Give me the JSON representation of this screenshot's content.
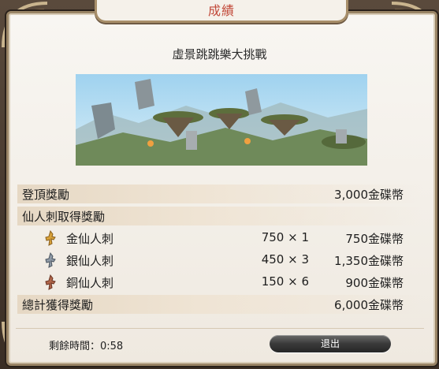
{
  "window": {
    "title": "成績"
  },
  "stage": {
    "name": "虛景跳跳樂大挑戰"
  },
  "rewards": {
    "summit": {
      "label": "登頂獎勵",
      "amount": "3,000金碟幣"
    },
    "cactus_header": {
      "label": "仙人刺取得獎勵"
    },
    "items": [
      {
        "icon": "gold-cactuar-icon",
        "label": "金仙人刺",
        "qty": "750 × 1",
        "amount": "750金碟幣"
      },
      {
        "icon": "silver-cactuar-icon",
        "label": "銀仙人刺",
        "qty": "450 × 3",
        "amount": "1,350金碟幣"
      },
      {
        "icon": "bronze-cactuar-icon",
        "label": "銅仙人刺",
        "qty": "150 × 6",
        "amount": "900金碟幣"
      }
    ],
    "total": {
      "label": "總計獲得獎勵",
      "amount": "6,000金碟幣"
    }
  },
  "footer": {
    "time_remaining": "剩餘時間：0:58",
    "exit_label": "退出"
  },
  "colors": {
    "title": "#c24a3a",
    "gold": "#d8a23a",
    "silver": "#8f9aa6",
    "bronze": "#b0664a"
  }
}
